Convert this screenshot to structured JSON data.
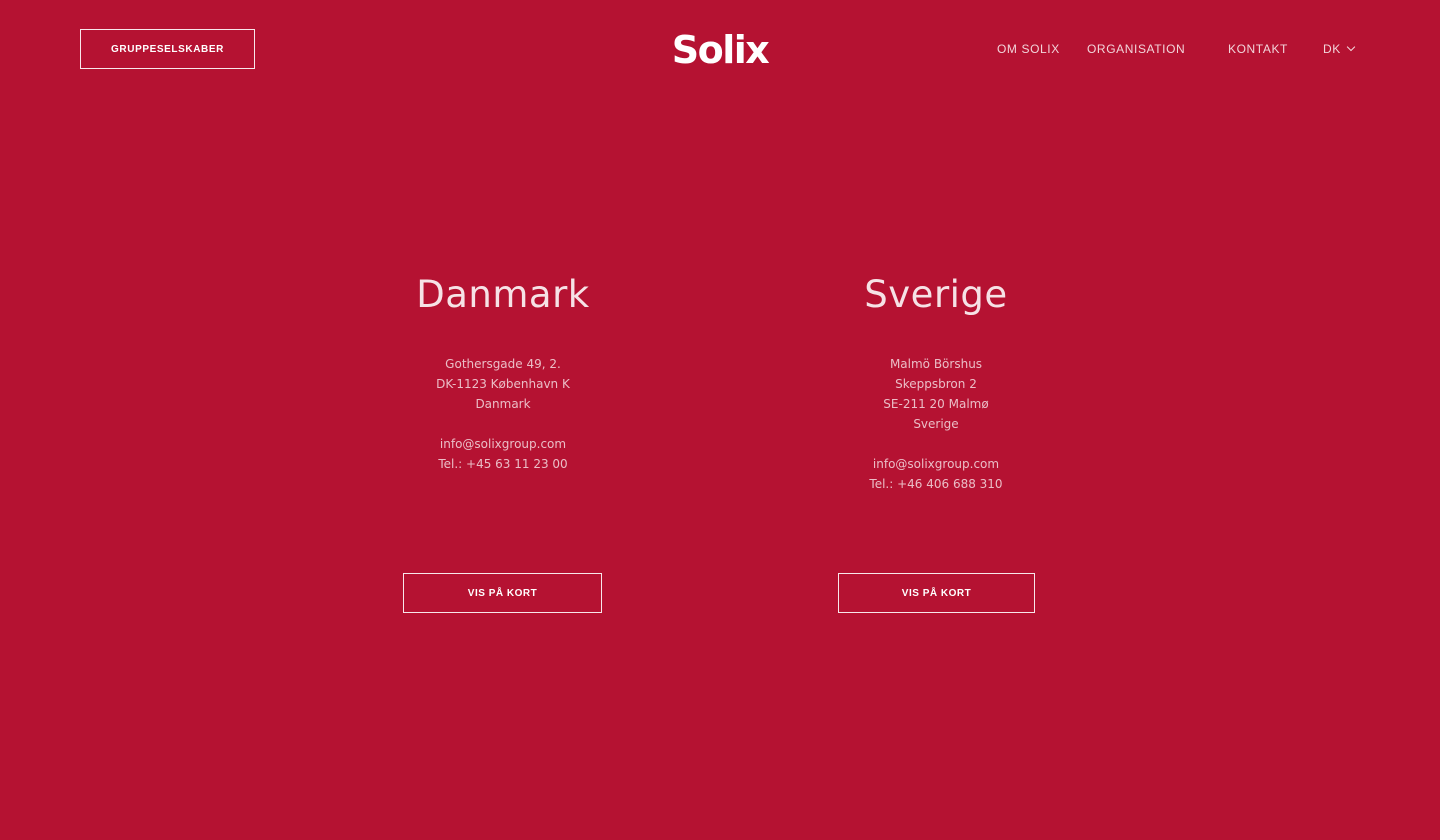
{
  "header": {
    "group_button": "GRUPPESELSKABER",
    "logo": "Solix",
    "nav": {
      "om_solix": "OM SOLIX",
      "organisation": "ORGANISATION",
      "kontakt": "KONTAKT",
      "language": "DK"
    }
  },
  "offices": [
    {
      "title": "Danmark",
      "address": [
        "Gothersgade 49, 2.",
        "DK-1123 København K",
        "Danmark"
      ],
      "email": "info@solixgroup.com",
      "phone": "Tel.: +45 63 11 23 00",
      "map_button": "VIS PÅ KORT"
    },
    {
      "title": "Sverige",
      "address": [
        "Malmö Börshus",
        "Skeppsbron 2",
        "SE-211 20 Malmø",
        "Sverige"
      ],
      "email": "info@solixgroup.com",
      "phone": "Tel.: +46 406 688 310",
      "map_button": "VIS PÅ KORT"
    }
  ],
  "colors": {
    "background": "#b51232",
    "text": "#ffffff"
  },
  "icons": {
    "language_dropdown": "chevron-down-icon"
  }
}
